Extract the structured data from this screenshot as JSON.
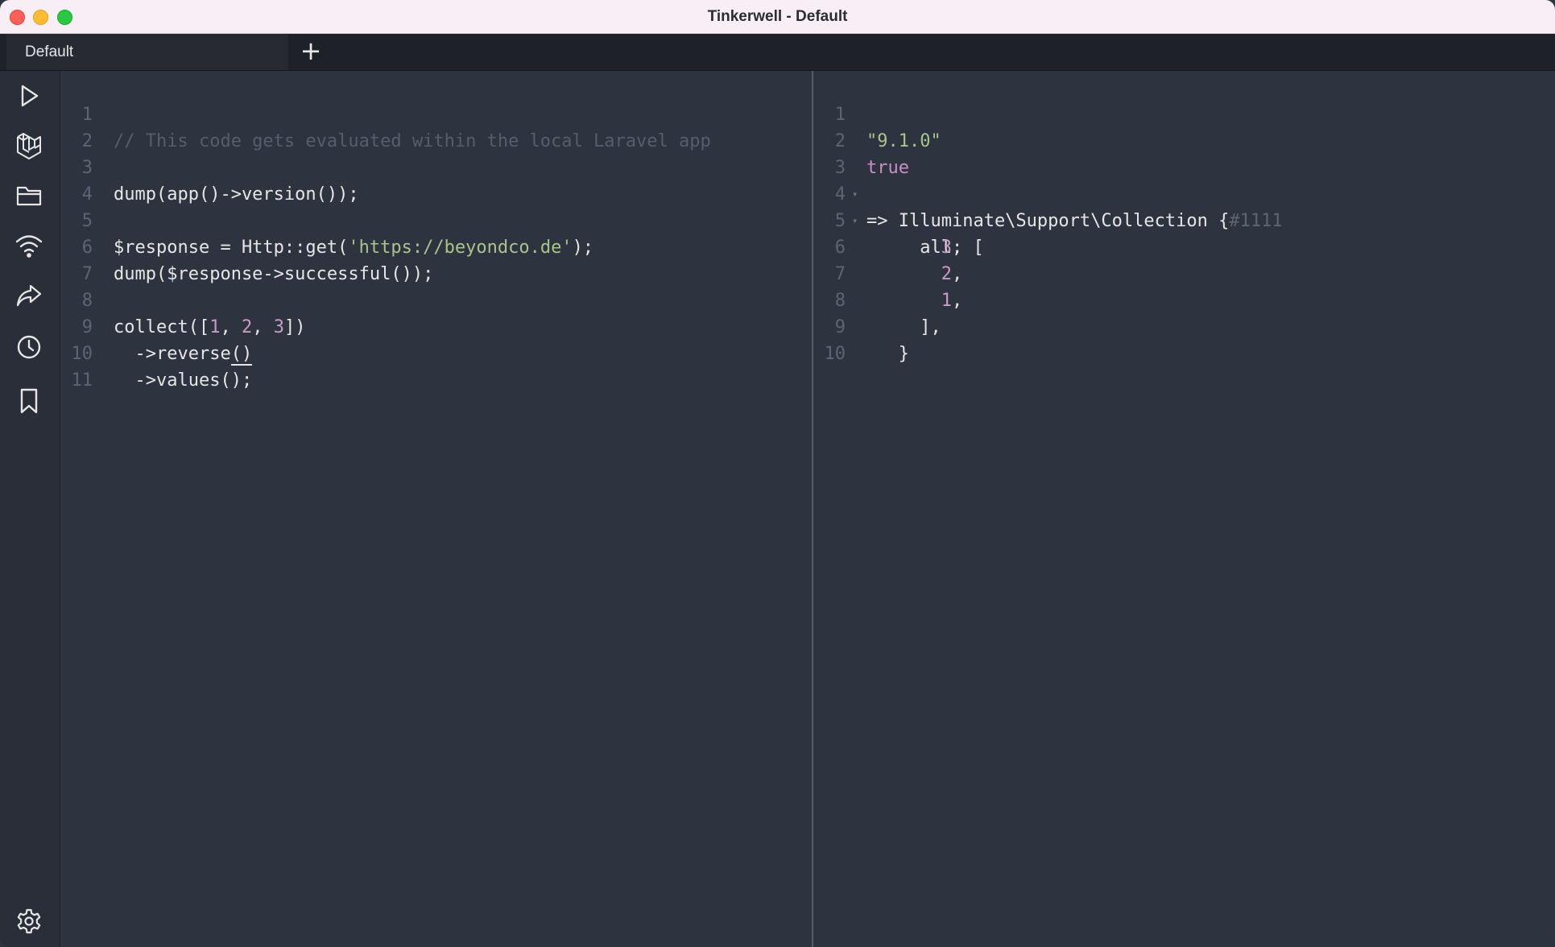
{
  "window": {
    "title": "Tinkerwell - Default"
  },
  "tabs": [
    {
      "label": "Default"
    }
  ],
  "add_tab_label": "+",
  "sidebar": {
    "icons": [
      "run-icon",
      "laravel-icon",
      "folder-icon",
      "wifi-icon",
      "share-icon",
      "history-icon",
      "bookmark-icon",
      "settings-icon"
    ]
  },
  "editor": {
    "lines": [
      {
        "n": "1",
        "text": "// This code gets evaluated within the local Laravel app"
      },
      {
        "n": "2",
        "text": ""
      },
      {
        "n": "3",
        "text": "dump(app()->version());"
      },
      {
        "n": "4",
        "text": ""
      },
      {
        "n": "5",
        "a": "$response = Http::get(",
        "s": "'https://beyondco.de'",
        "b": ");"
      },
      {
        "n": "6",
        "text": "dump($response->successful());"
      },
      {
        "n": "7",
        "text": ""
      },
      {
        "n": "8",
        "a": "collect([",
        "n1": "1",
        "c1": ", ",
        "n2": "2",
        "c2": ", ",
        "n3": "3",
        "b": "])"
      },
      {
        "n": "9",
        "a": "  ->reverse",
        "u": "()",
        "b": ""
      },
      {
        "n": "10",
        "text": "  ->values();"
      },
      {
        "n": "11",
        "text": ""
      }
    ]
  },
  "output": {
    "lines": [
      {
        "n": "1",
        "str": "\"9.1.0\""
      },
      {
        "n": "2",
        "kw": "true"
      },
      {
        "n": "3",
        "text": "=> Illuminate\\Support\\Collection {",
        "dim": "#1111",
        "fold": "▾"
      },
      {
        "n": "4",
        "text": "     all: [",
        "fold": "▾"
      },
      {
        "n": "5",
        "pre": "       ",
        "num": "3",
        "post": ","
      },
      {
        "n": "6",
        "pre": "       ",
        "num": "2",
        "post": ","
      },
      {
        "n": "7",
        "pre": "       ",
        "num": "1",
        "post": ","
      },
      {
        "n": "8",
        "text": "     ],"
      },
      {
        "n": "9",
        "text": "   }"
      },
      {
        "n": "10",
        "text": ""
      }
    ]
  }
}
